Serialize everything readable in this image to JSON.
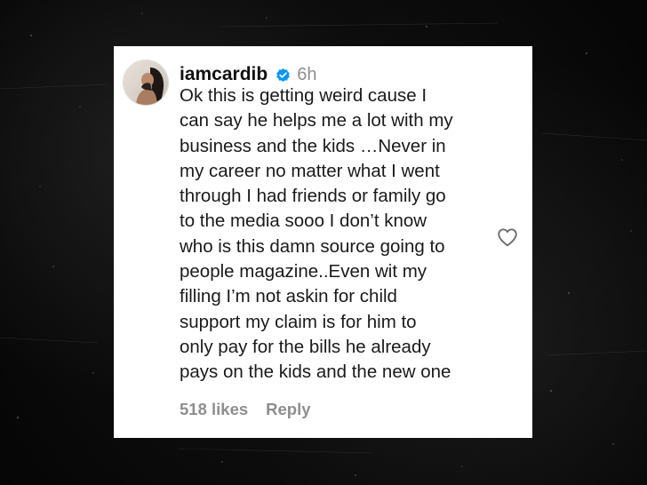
{
  "comment": {
    "username": "iamcardib",
    "verified_icon": "verified-badge-icon",
    "timestamp": "6h",
    "lines": [
      "Ok this is getting weird cause I",
      "can say he helps me a lot with my",
      "business and the kids …Never in",
      "my career no matter what I went",
      "through I had friends or family go",
      "to the media sooo I don’t know",
      "who is this damn source going to",
      "people magazine..Even wit my",
      "filling I’m not askin for child",
      "support my claim is for him to",
      "only pay for the bills he already",
      "pays on the kids and the new one"
    ],
    "likes": "518 likes",
    "reply_label": "Reply",
    "like_icon": "heart-outline-icon"
  },
  "colors": {
    "card_background": "#ffffff",
    "page_background": "#0b0b0b",
    "verified_blue": "#0095f6",
    "muted_text": "#8e8e8e",
    "body_text": "#1a1a1a"
  }
}
